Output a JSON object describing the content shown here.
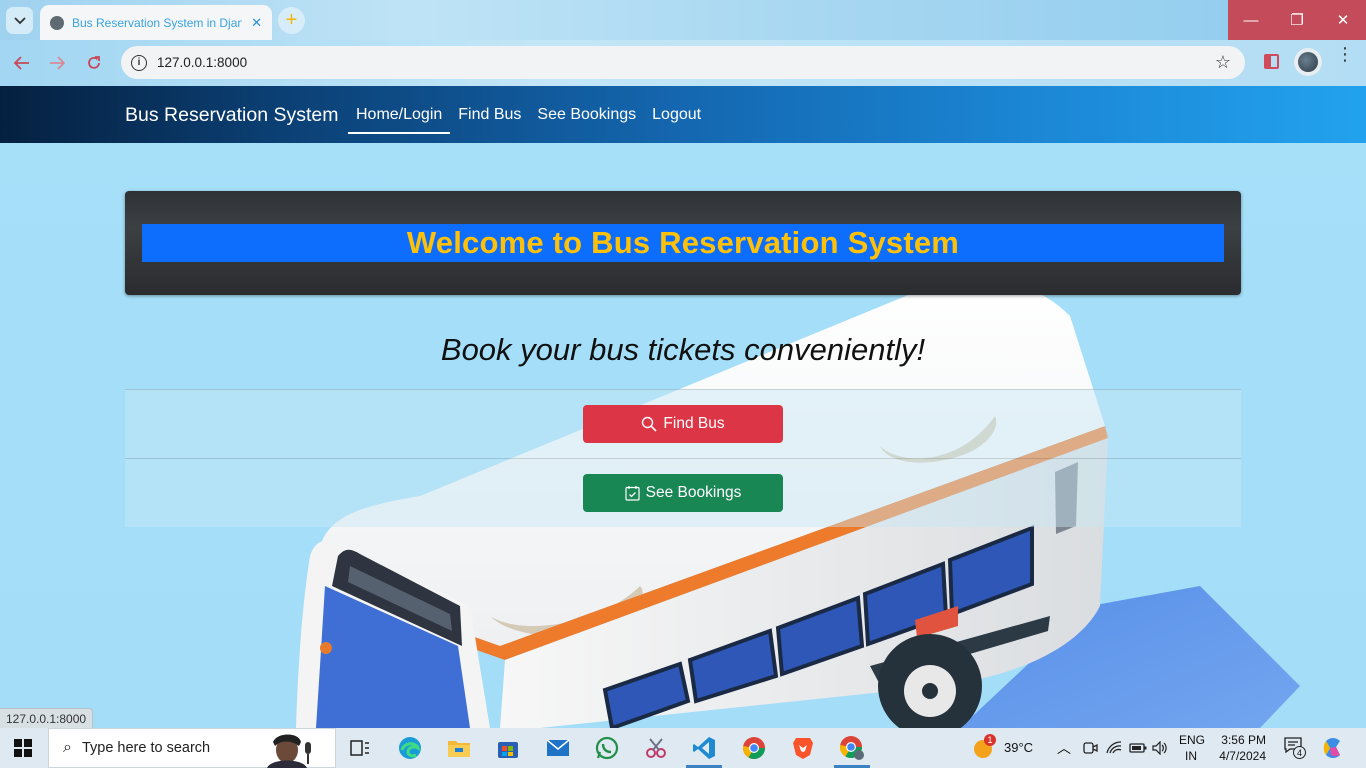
{
  "browser": {
    "tab_title": "Bus Reservation System in Djan",
    "tab_close": "✕",
    "new_tab": "+",
    "url": "127.0.0.1:8000",
    "window_controls": {
      "minimize": "—",
      "restore": "❐",
      "close": "✕"
    },
    "status_url": "127.0.0.1:8000"
  },
  "navbar": {
    "brand": "Bus Reservation System",
    "links": [
      {
        "label": "Home/Login",
        "active": true
      },
      {
        "label": "Find Bus",
        "active": false
      },
      {
        "label": "See Bookings",
        "active": false
      },
      {
        "label": "Logout",
        "active": false
      }
    ]
  },
  "hero": {
    "title": "Welcome to Bus Reservation System"
  },
  "tagline": "Book your bus tickets conveniently!",
  "actions": {
    "find_bus": {
      "label": "Find Bus",
      "icon": "search-icon",
      "color": "#dc3545"
    },
    "see_bookings": {
      "label": "See Bookings",
      "icon": "calendar-check-icon",
      "color": "#198754"
    }
  },
  "colors": {
    "hero_band": "#0d6efd",
    "hero_title": "#ffc107",
    "page_bg": "#a5dff8"
  },
  "taskbar": {
    "search_placeholder": "Type here to search",
    "weather_badge": "1",
    "temperature": "39°C",
    "lang_top": "ENG",
    "lang_bottom": "IN",
    "time": "3:56 PM",
    "date": "4/7/2024",
    "notification_count": "4",
    "apps": [
      "task-view-icon",
      "edge-icon",
      "file-explorer-icon",
      "store-icon",
      "mail-icon",
      "whatsapp-icon",
      "snipping-icon",
      "vscode-icon",
      "chrome-icon",
      "brave-icon",
      "chrome-profile-icon"
    ]
  }
}
